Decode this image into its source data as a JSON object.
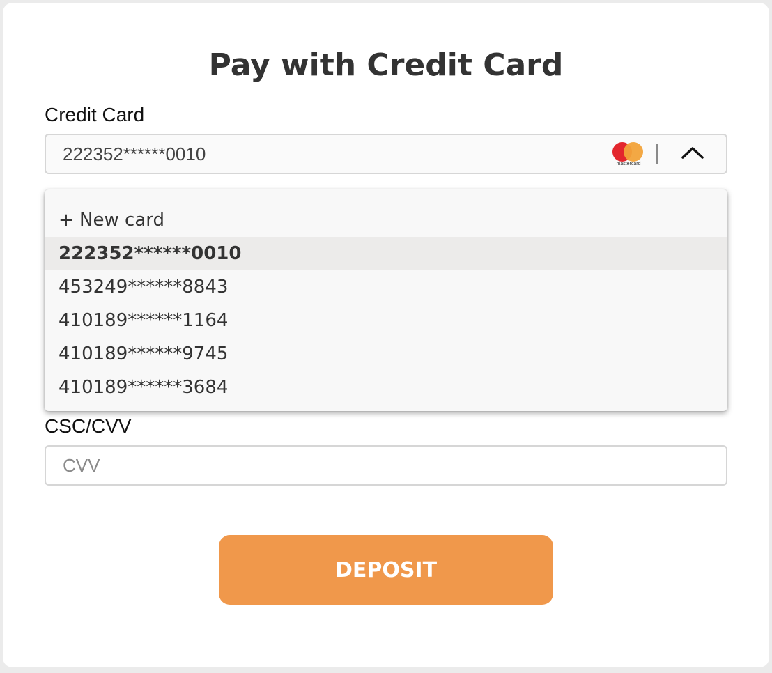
{
  "title": "Pay with Credit Card",
  "credit_card": {
    "label": "Credit Card",
    "selected_value": "222352******0010",
    "brand_logo_text": "mastercard",
    "brand_icon": "mastercard-icon",
    "toggle_icon": "chevron-up-icon"
  },
  "dropdown": {
    "options": [
      "+ New card",
      "222352******0010",
      "453249******8843",
      "410189******1164",
      "410189******9745",
      "410189******3684"
    ],
    "selected_index": 1
  },
  "cvv": {
    "label": "CSC/CVV",
    "placeholder": "CVV",
    "value": ""
  },
  "deposit_button": {
    "label": "DEPOSIT"
  },
  "colors": {
    "accent": "#f0984b",
    "title": "#333333",
    "mastercard_red": "#e3262d",
    "mastercard_orange": "#f2a33a"
  }
}
